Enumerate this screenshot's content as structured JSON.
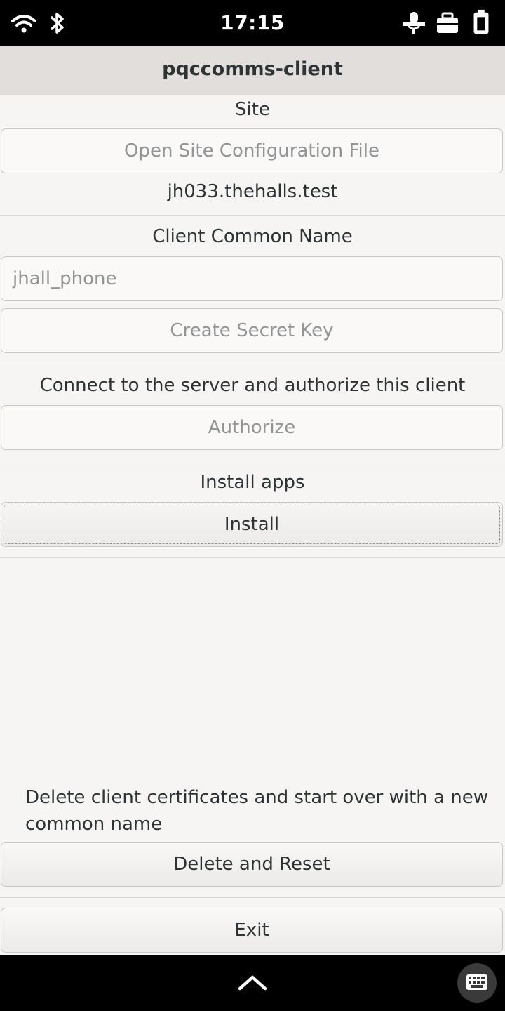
{
  "status_bar": {
    "time": "17:15",
    "icons": [
      "wifi-icon",
      "bluetooth-icon",
      "microphone-muted-icon",
      "vpn-icon",
      "battery-icon"
    ]
  },
  "header": {
    "title": "pqccomms-client"
  },
  "site": {
    "label": "Site",
    "open_button": "Open Site Configuration File",
    "site_name": "jh033.thehalls.test"
  },
  "client": {
    "label": "Client Common Name",
    "common_name_value": "jhall_phone",
    "create_key_button": "Create Secret Key"
  },
  "authorize": {
    "label": "Connect to the server and authorize this client",
    "button": "Authorize"
  },
  "install": {
    "label": "Install apps",
    "button": "Install"
  },
  "reset": {
    "label": "Delete client certificates and start over with a new common name",
    "button": "Delete and Reset"
  },
  "exit": {
    "button": "Exit"
  },
  "nav": {
    "icons": [
      "chevron-up-icon",
      "keyboard-icon"
    ]
  },
  "colors": {
    "background": "#f6f5f4",
    "header": "#e1dedb",
    "disabled_text": "#929595"
  }
}
